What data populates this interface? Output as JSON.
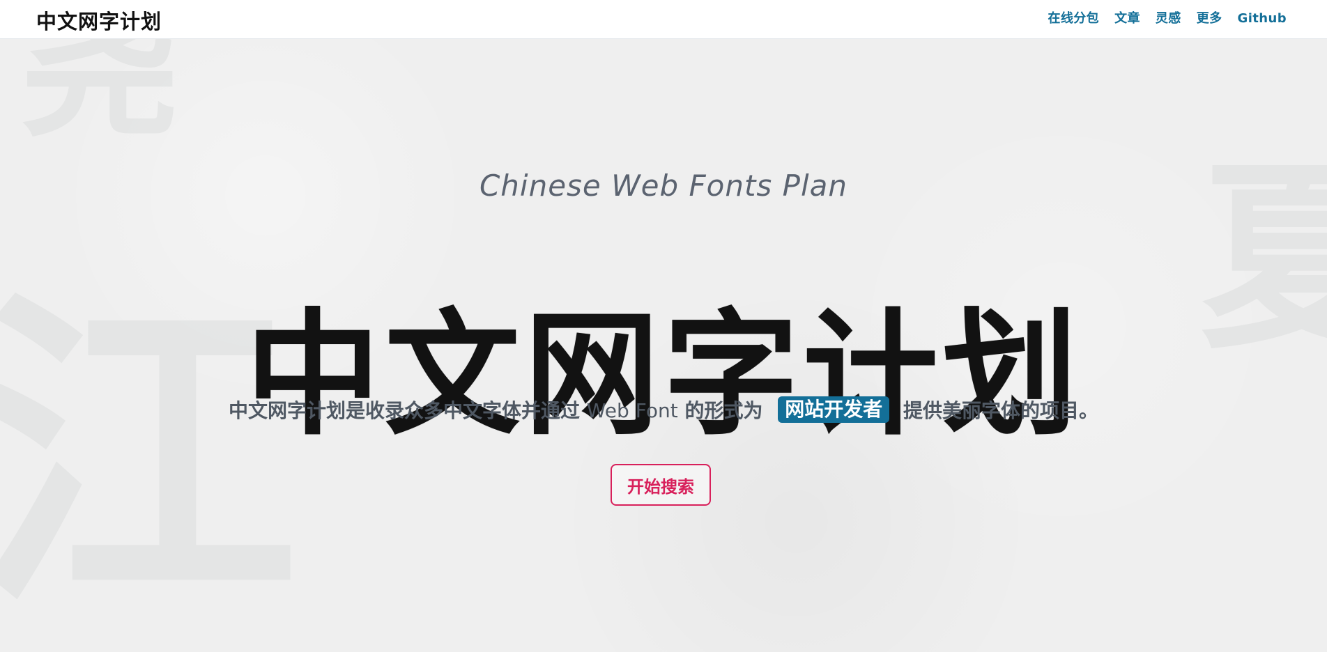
{
  "header": {
    "brand": "中文网字计划",
    "nav": [
      {
        "label": "在线分包"
      },
      {
        "label": "文章"
      },
      {
        "label": "灵感"
      },
      {
        "label": "更多"
      },
      {
        "label": "Github"
      }
    ]
  },
  "hero": {
    "subtitle": "Chinese Web Fonts Plan",
    "title": "中文网字计划",
    "description": {
      "part1": "中文网字计划是收录众多中文字体并通过",
      "web_font": "Web Font",
      "part2": "的形式为",
      "highlight": "网站开发者",
      "part3": "提供美丽字体的项目。"
    },
    "cta": "开始搜索",
    "background_chars": [
      "尧",
      "江",
      "夏"
    ]
  },
  "colors": {
    "nav_blue": "#136f98",
    "cta_red": "#d8205b",
    "page_bg": "#efefef"
  }
}
